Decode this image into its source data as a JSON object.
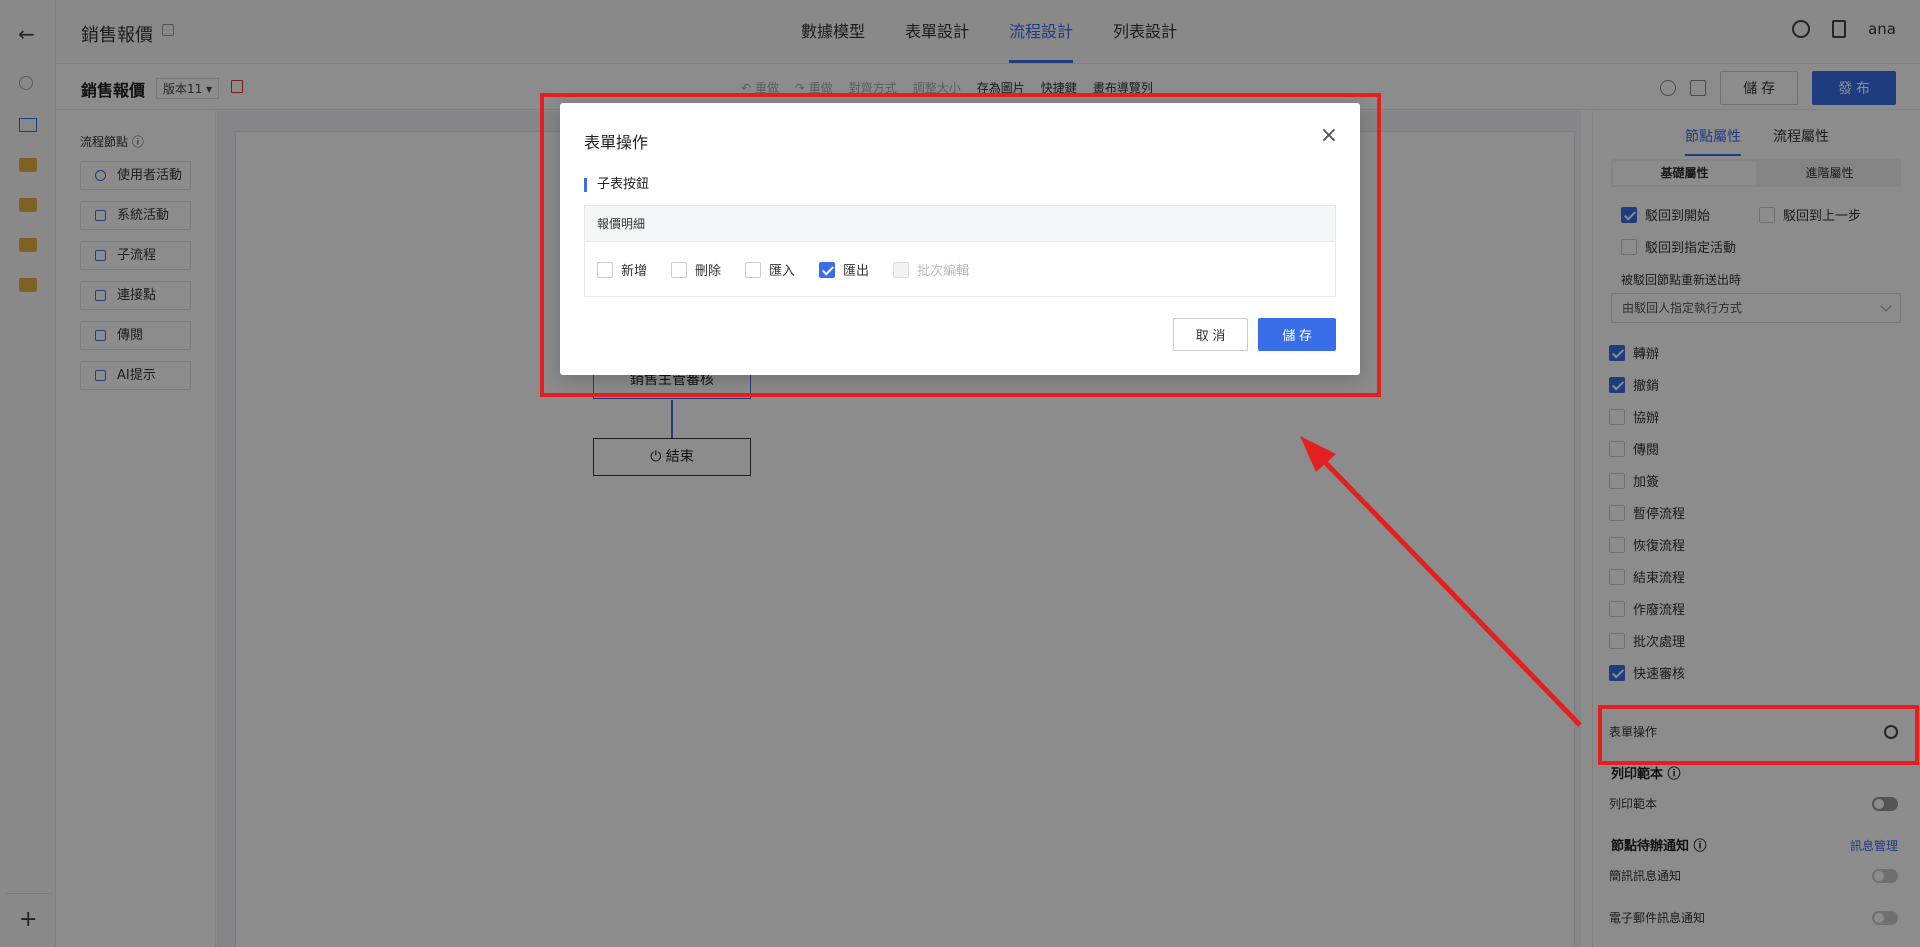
{
  "header": {
    "title": "銷售報價",
    "tabs": [
      "數據模型",
      "表單設計",
      "流程設計",
      "列表設計"
    ],
    "active_tab": "流程設計",
    "user": "ana"
  },
  "toolbar": {
    "title": "銷售報價",
    "version": "版本11 ▾",
    "undo": "↶ 重做",
    "redo": "↷ 重做",
    "align": "對齊方式",
    "resize": "調整大小",
    "save_image": "存為圖片",
    "shortcuts": "快捷鍵",
    "publish_preview": "畫布導覽列",
    "save_label": "儲 存",
    "publish_label": "發 布"
  },
  "palette": {
    "title": "流程節點 ⓘ",
    "items": [
      "使用者活動",
      "系統活動",
      "子流程",
      "連接點",
      "傳閱",
      "AI提示"
    ]
  },
  "canvas": {
    "node_review": "銷售主管審核",
    "node_end": "⏻ 結束"
  },
  "props": {
    "tabs": [
      "節點屬性",
      "流程屬性"
    ],
    "subtabs": [
      "基礎屬性",
      "進階屬性"
    ],
    "reject_start": "駁回到開始",
    "reject_prev": "駁回到上一步",
    "reject_specific": "駁回到指定活動",
    "resubmit_label": "被駁回節點重新送出時",
    "resubmit_value": "由駁回人指定執行方式",
    "options": [
      {
        "label": "轉辦",
        "checked": true
      },
      {
        "label": "撤銷",
        "checked": true
      },
      {
        "label": "協辦",
        "checked": false
      },
      {
        "label": "傳閱",
        "checked": false
      },
      {
        "label": "加簽",
        "checked": false
      },
      {
        "label": "暫停流程",
        "checked": false
      },
      {
        "label": "恢復流程",
        "checked": false
      },
      {
        "label": "結束流程",
        "checked": false
      },
      {
        "label": "作廢流程",
        "checked": false
      },
      {
        "label": "批次處理",
        "checked": false
      },
      {
        "label": "快速審核",
        "checked": true
      }
    ],
    "form_ops": "表單操作",
    "print_section": "列印範本 ⓘ",
    "print_label": "列印範本",
    "notify_section": "節點待辦通知 ⓘ",
    "notify_link": "訊息管理",
    "sms": "簡訊訊息通知",
    "email": "電子郵件訊息通知"
  },
  "modal": {
    "title": "表單操作",
    "section": "子表按鈕",
    "table_header": "報價明細",
    "options": [
      {
        "label": "新增",
        "checked": false,
        "disabled": false
      },
      {
        "label": "刪除",
        "checked": false,
        "disabled": false
      },
      {
        "label": "匯入",
        "checked": false,
        "disabled": false
      },
      {
        "label": "匯出",
        "checked": true,
        "disabled": false
      },
      {
        "label": "批次編輯",
        "checked": false,
        "disabled": true
      }
    ],
    "cancel": "取 消",
    "save": "儲 存"
  },
  "colors": {
    "accent": "#3a6ee8",
    "highlight": "#e3201f"
  }
}
